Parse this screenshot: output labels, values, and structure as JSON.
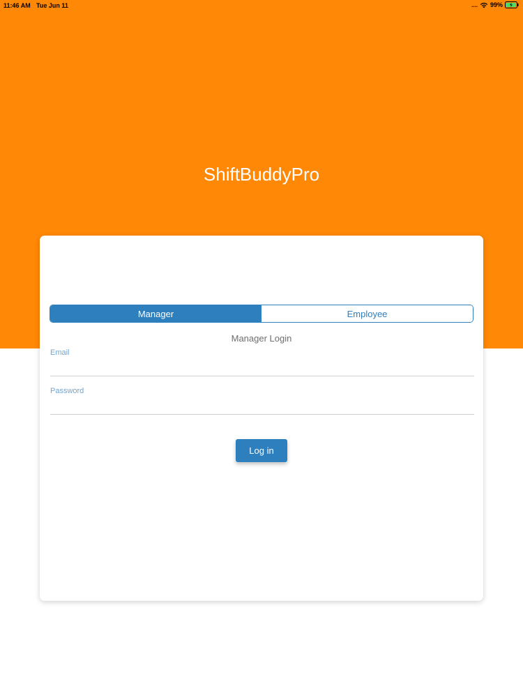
{
  "status_bar": {
    "time": "11:46 AM",
    "date": "Tue Jun 11",
    "signal": "....",
    "wifi_icon": "wifi-icon",
    "battery_percent": "99%",
    "battery_icon": "battery-charging-icon"
  },
  "header": {
    "app_title": "ShiftBuddyPro",
    "background_color": "#ff8806"
  },
  "login_card": {
    "segments": [
      {
        "label": "Manager",
        "selected": true
      },
      {
        "label": "Employee",
        "selected": false
      }
    ],
    "heading": "Manager Login",
    "email": {
      "label": "Email",
      "value": ""
    },
    "password": {
      "label": "Password",
      "value": ""
    },
    "login_button": "Log in",
    "accent_color": "#2d7fbd"
  }
}
